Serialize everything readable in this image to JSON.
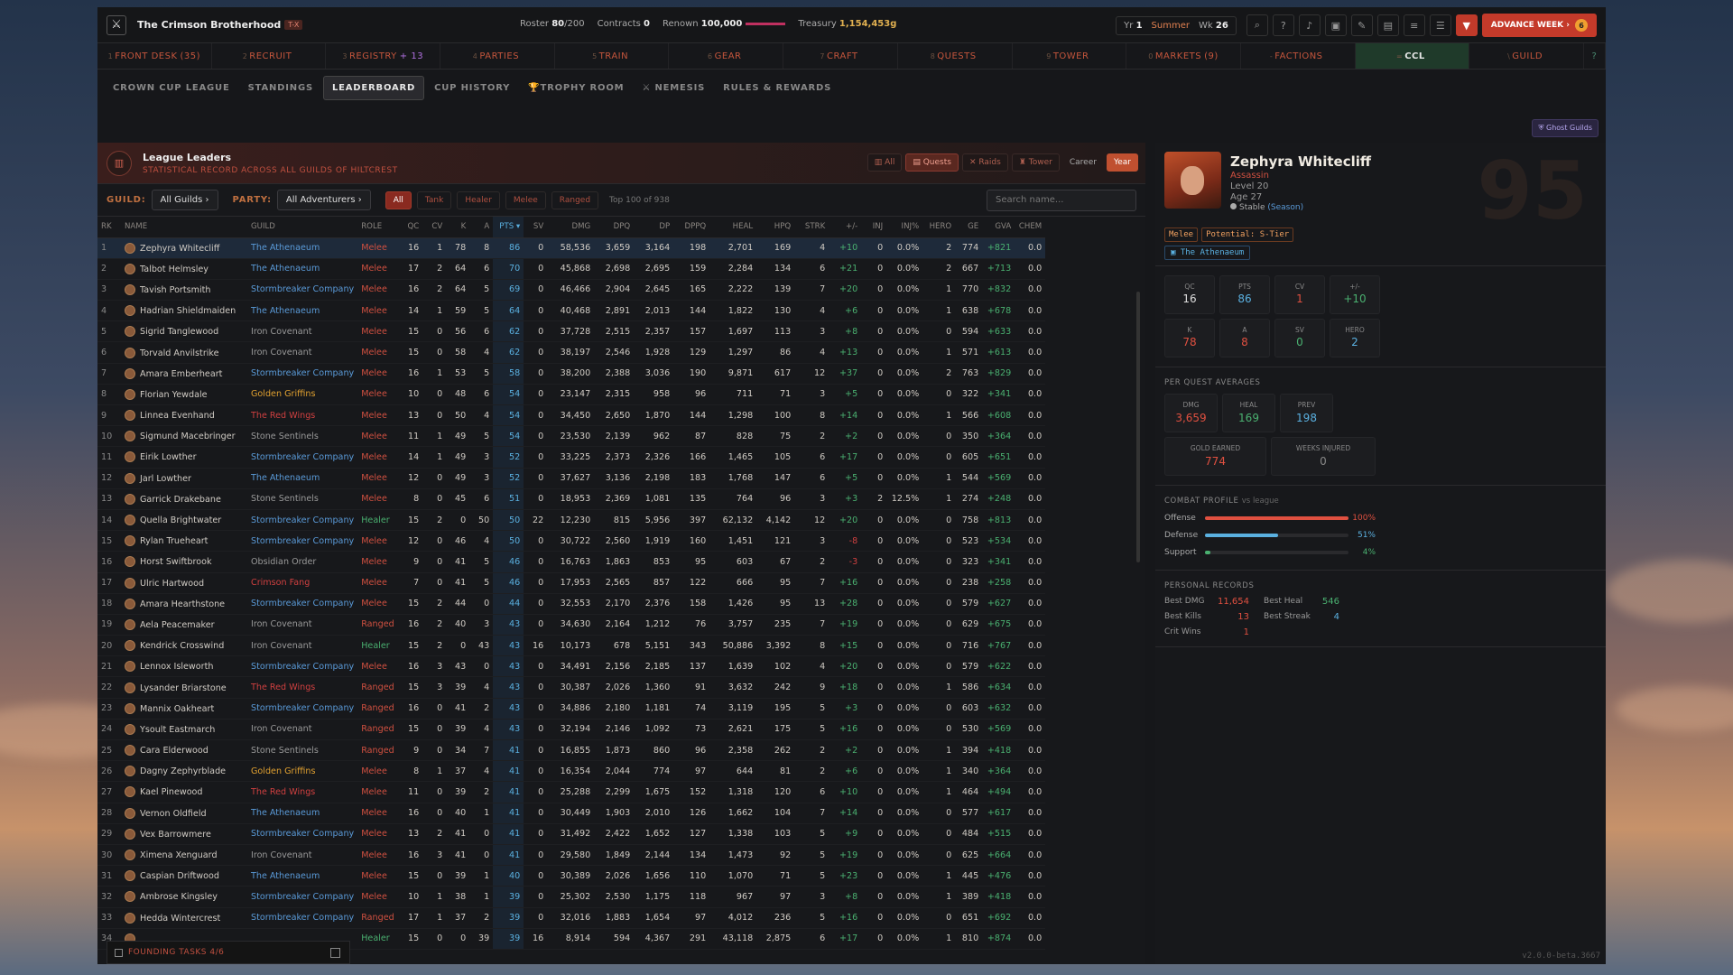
{
  "app": {
    "guild_name": "The Crimson Brotherhood",
    "guild_tag": "T-X",
    "roster_label": "Roster",
    "roster_value": "80",
    "roster_max": "/200",
    "contracts_label": "Contracts",
    "contracts_value": "0",
    "renown_label": "Renown",
    "renown_value": "100,000",
    "treasury_label": "Treasury",
    "treasury_value": "1,154,453g",
    "year_label": "Yr",
    "year_value": "1",
    "season": "Summer",
    "week_label": "Wk",
    "week_value": "26",
    "advance_label": "ADVANCE WEEK ›",
    "advance_badge": "6",
    "version": "v2.0.0-beta.3667"
  },
  "main_nav": [
    {
      "key": "1",
      "label": "FRONT DESK",
      "extra": "(35)"
    },
    {
      "key": "2",
      "label": "RECRUIT",
      "extra": ""
    },
    {
      "key": "3",
      "label": "REGISTRY",
      "extra": "+ 13"
    },
    {
      "key": "4",
      "label": "PARTIES",
      "extra": ""
    },
    {
      "key": "5",
      "label": "TRAIN",
      "extra": ""
    },
    {
      "key": "6",
      "label": "GEAR",
      "extra": ""
    },
    {
      "key": "7",
      "label": "CRAFT",
      "extra": ""
    },
    {
      "key": "8",
      "label": "QUESTS",
      "extra": ""
    },
    {
      "key": "9",
      "label": "TOWER",
      "extra": ""
    },
    {
      "key": "0",
      "label": "MARKETS",
      "extra": "(9)"
    },
    {
      "key": "-",
      "label": "FACTIONS",
      "extra": ""
    },
    {
      "key": "=",
      "label": "CCL",
      "extra": ""
    },
    {
      "key": "\\",
      "label": "GUILD",
      "extra": ""
    }
  ],
  "sub_nav": [
    "CROWN CUP LEAGUE",
    "STANDINGS",
    "LEADERBOARD",
    "CUP HISTORY",
    "TROPHY ROOM",
    "NEMESIS",
    "RULES & REWARDS"
  ],
  "ghost_guilds": "Ghost Guilds",
  "leaders": {
    "title": "League Leaders",
    "subtitle": "STATISTICAL RECORD ACROSS ALL GUILDS OF HILTCREST",
    "btn_all": "All",
    "btn_quests": "Quests",
    "btn_raids": "Raids",
    "btn_tower": "Tower",
    "btn_career": "Career",
    "btn_year": "Year"
  },
  "filters": {
    "guild_label": "GUILD:",
    "guild_value": "All Guilds ›",
    "party_label": "PARTY:",
    "party_value": "All Adventurers ›",
    "chips": [
      "All",
      "Tank",
      "Healer",
      "Melee",
      "Ranged"
    ],
    "top_text": "Top 100 of 938",
    "search_placeholder": "Search name..."
  },
  "columns": [
    "RK",
    "NAME",
    "GUILD",
    "ROLE",
    "QC",
    "CV",
    "K",
    "A",
    "PTS ▾",
    "SV",
    "DMG",
    "DPQ",
    "DP",
    "DPPQ",
    "HEAL",
    "HPQ",
    "STRK",
    "+/-",
    "INJ",
    "INJ%",
    "HERO",
    "GE",
    "GVA",
    "CHEM"
  ],
  "rows": [
    [
      "1",
      "Zephyra Whitecliff",
      "The Athenaeum",
      "Melee",
      "16",
      "1",
      "78",
      "8",
      "86",
      "0",
      "58,536",
      "3,659",
      "3,164",
      "198",
      "2,701",
      "169",
      "4",
      "+10",
      "0",
      "0.0%",
      "2",
      "774",
      "+821",
      "0.0"
    ],
    [
      "2",
      "Talbot Helmsley",
      "The Athenaeum",
      "Melee",
      "17",
      "2",
      "64",
      "6",
      "70",
      "0",
      "45,868",
      "2,698",
      "2,695",
      "159",
      "2,284",
      "134",
      "6",
      "+21",
      "0",
      "0.0%",
      "2",
      "667",
      "+713",
      "0.0"
    ],
    [
      "3",
      "Tavish Portsmith",
      "Stormbreaker Company",
      "Melee",
      "16",
      "2",
      "64",
      "5",
      "69",
      "0",
      "46,466",
      "2,904",
      "2,645",
      "165",
      "2,222",
      "139",
      "7",
      "+20",
      "0",
      "0.0%",
      "1",
      "770",
      "+832",
      "0.0"
    ],
    [
      "4",
      "Hadrian Shieldmaiden",
      "The Athenaeum",
      "Melee",
      "14",
      "1",
      "59",
      "5",
      "64",
      "0",
      "40,468",
      "2,891",
      "2,013",
      "144",
      "1,822",
      "130",
      "4",
      "+6",
      "0",
      "0.0%",
      "1",
      "638",
      "+678",
      "0.0"
    ],
    [
      "5",
      "Sigrid Tanglewood",
      "Iron Covenant",
      "Melee",
      "15",
      "0",
      "56",
      "6",
      "62",
      "0",
      "37,728",
      "2,515",
      "2,357",
      "157",
      "1,697",
      "113",
      "3",
      "+8",
      "0",
      "0.0%",
      "0",
      "594",
      "+633",
      "0.0"
    ],
    [
      "6",
      "Torvald Anvilstrike",
      "Iron Covenant",
      "Melee",
      "15",
      "0",
      "58",
      "4",
      "62",
      "0",
      "38,197",
      "2,546",
      "1,928",
      "129",
      "1,297",
      "86",
      "4",
      "+13",
      "0",
      "0.0%",
      "1",
      "571",
      "+613",
      "0.0"
    ],
    [
      "7",
      "Amara Emberheart",
      "Stormbreaker Company",
      "Melee",
      "16",
      "1",
      "53",
      "5",
      "58",
      "0",
      "38,200",
      "2,388",
      "3,036",
      "190",
      "9,871",
      "617",
      "12",
      "+37",
      "0",
      "0.0%",
      "2",
      "763",
      "+829",
      "0.0"
    ],
    [
      "8",
      "Florian Yewdale",
      "Golden Griffins",
      "Melee",
      "10",
      "0",
      "48",
      "6",
      "54",
      "0",
      "23,147",
      "2,315",
      "958",
      "96",
      "711",
      "71",
      "3",
      "+5",
      "0",
      "0.0%",
      "0",
      "322",
      "+341",
      "0.0"
    ],
    [
      "9",
      "Linnea Evenhand",
      "The Red Wings",
      "Melee",
      "13",
      "0",
      "50",
      "4",
      "54",
      "0",
      "34,450",
      "2,650",
      "1,870",
      "144",
      "1,298",
      "100",
      "8",
      "+14",
      "0",
      "0.0%",
      "1",
      "566",
      "+608",
      "0.0"
    ],
    [
      "10",
      "Sigmund Macebringer",
      "Stone Sentinels",
      "Melee",
      "11",
      "1",
      "49",
      "5",
      "54",
      "0",
      "23,530",
      "2,139",
      "962",
      "87",
      "828",
      "75",
      "2",
      "+2",
      "0",
      "0.0%",
      "0",
      "350",
      "+364",
      "0.0"
    ],
    [
      "11",
      "Eirik Lowther",
      "Stormbreaker Company",
      "Melee",
      "14",
      "1",
      "49",
      "3",
      "52",
      "0",
      "33,225",
      "2,373",
      "2,326",
      "166",
      "1,465",
      "105",
      "6",
      "+17",
      "0",
      "0.0%",
      "0",
      "605",
      "+651",
      "0.0"
    ],
    [
      "12",
      "Jarl Lowther",
      "The Athenaeum",
      "Melee",
      "12",
      "0",
      "49",
      "3",
      "52",
      "0",
      "37,627",
      "3,136",
      "2,198",
      "183",
      "1,768",
      "147",
      "6",
      "+5",
      "0",
      "0.0%",
      "1",
      "544",
      "+569",
      "0.0"
    ],
    [
      "13",
      "Garrick Drakebane",
      "Stone Sentinels",
      "Melee",
      "8",
      "0",
      "45",
      "6",
      "51",
      "0",
      "18,953",
      "2,369",
      "1,081",
      "135",
      "764",
      "96",
      "3",
      "+3",
      "2",
      "12.5%",
      "1",
      "274",
      "+248",
      "0.0"
    ],
    [
      "14",
      "Quella Brightwater",
      "Stormbreaker Company",
      "Healer",
      "15",
      "2",
      "0",
      "50",
      "50",
      "22",
      "12,230",
      "815",
      "5,956",
      "397",
      "62,132",
      "4,142",
      "12",
      "+20",
      "0",
      "0.0%",
      "0",
      "758",
      "+813",
      "0.0"
    ],
    [
      "15",
      "Rylan Trueheart",
      "Stormbreaker Company",
      "Melee",
      "12",
      "0",
      "46",
      "4",
      "50",
      "0",
      "30,722",
      "2,560",
      "1,919",
      "160",
      "1,451",
      "121",
      "3",
      "-8",
      "0",
      "0.0%",
      "0",
      "523",
      "+534",
      "0.0"
    ],
    [
      "16",
      "Horst Swiftbrook",
      "Obsidian Order",
      "Melee",
      "9",
      "0",
      "41",
      "5",
      "46",
      "0",
      "16,763",
      "1,863",
      "853",
      "95",
      "603",
      "67",
      "2",
      "-3",
      "0",
      "0.0%",
      "0",
      "323",
      "+341",
      "0.0"
    ],
    [
      "17",
      "Ulric Hartwood",
      "Crimson Fang",
      "Melee",
      "7",
      "0",
      "41",
      "5",
      "46",
      "0",
      "17,953",
      "2,565",
      "857",
      "122",
      "666",
      "95",
      "7",
      "+16",
      "0",
      "0.0%",
      "0",
      "238",
      "+258",
      "0.0"
    ],
    [
      "18",
      "Amara Hearthstone",
      "Stormbreaker Company",
      "Melee",
      "15",
      "2",
      "44",
      "0",
      "44",
      "0",
      "32,553",
      "2,170",
      "2,376",
      "158",
      "1,426",
      "95",
      "13",
      "+28",
      "0",
      "0.0%",
      "0",
      "579",
      "+627",
      "0.0"
    ],
    [
      "19",
      "Aela Peacemaker",
      "Iron Covenant",
      "Ranged",
      "16",
      "2",
      "40",
      "3",
      "43",
      "0",
      "34,630",
      "2,164",
      "1,212",
      "76",
      "3,757",
      "235",
      "7",
      "+19",
      "0",
      "0.0%",
      "0",
      "629",
      "+675",
      "0.0"
    ],
    [
      "20",
      "Kendrick Crosswind",
      "Iron Covenant",
      "Healer",
      "15",
      "2",
      "0",
      "43",
      "43",
      "16",
      "10,173",
      "678",
      "5,151",
      "343",
      "50,886",
      "3,392",
      "8",
      "+15",
      "0",
      "0.0%",
      "0",
      "716",
      "+767",
      "0.0"
    ],
    [
      "21",
      "Lennox Isleworth",
      "Stormbreaker Company",
      "Melee",
      "16",
      "3",
      "43",
      "0",
      "43",
      "0",
      "34,491",
      "2,156",
      "2,185",
      "137",
      "1,639",
      "102",
      "4",
      "+20",
      "0",
      "0.0%",
      "0",
      "579",
      "+622",
      "0.0"
    ],
    [
      "22",
      "Lysander Briarstone",
      "The Red Wings",
      "Ranged",
      "15",
      "3",
      "39",
      "4",
      "43",
      "0",
      "30,387",
      "2,026",
      "1,360",
      "91",
      "3,632",
      "242",
      "9",
      "+18",
      "0",
      "0.0%",
      "1",
      "586",
      "+634",
      "0.0"
    ],
    [
      "23",
      "Mannix Oakheart",
      "Stormbreaker Company",
      "Ranged",
      "16",
      "0",
      "41",
      "2",
      "43",
      "0",
      "34,886",
      "2,180",
      "1,181",
      "74",
      "3,119",
      "195",
      "5",
      "+3",
      "0",
      "0.0%",
      "0",
      "603",
      "+632",
      "0.0"
    ],
    [
      "24",
      "Ysoult Eastmarch",
      "Iron Covenant",
      "Ranged",
      "15",
      "0",
      "39",
      "4",
      "43",
      "0",
      "32,194",
      "2,146",
      "1,092",
      "73",
      "2,621",
      "175",
      "5",
      "+16",
      "0",
      "0.0%",
      "0",
      "530",
      "+569",
      "0.0"
    ],
    [
      "25",
      "Cara Elderwood",
      "Stone Sentinels",
      "Ranged",
      "9",
      "0",
      "34",
      "7",
      "41",
      "0",
      "16,855",
      "1,873",
      "860",
      "96",
      "2,358",
      "262",
      "2",
      "+2",
      "0",
      "0.0%",
      "1",
      "394",
      "+418",
      "0.0"
    ],
    [
      "26",
      "Dagny Zephyrblade",
      "Golden Griffins",
      "Melee",
      "8",
      "1",
      "37",
      "4",
      "41",
      "0",
      "16,354",
      "2,044",
      "774",
      "97",
      "644",
      "81",
      "2",
      "+6",
      "0",
      "0.0%",
      "1",
      "340",
      "+364",
      "0.0"
    ],
    [
      "27",
      "Kael Pinewood",
      "The Red Wings",
      "Melee",
      "11",
      "0",
      "39",
      "2",
      "41",
      "0",
      "25,288",
      "2,299",
      "1,675",
      "152",
      "1,318",
      "120",
      "6",
      "+10",
      "0",
      "0.0%",
      "1",
      "464",
      "+494",
      "0.0"
    ],
    [
      "28",
      "Vernon Oldfield",
      "The Athenaeum",
      "Melee",
      "16",
      "0",
      "40",
      "1",
      "41",
      "0",
      "30,449",
      "1,903",
      "2,010",
      "126",
      "1,662",
      "104",
      "7",
      "+14",
      "0",
      "0.0%",
      "0",
      "577",
      "+617",
      "0.0"
    ],
    [
      "29",
      "Vex Barrowmere",
      "Stormbreaker Company",
      "Melee",
      "13",
      "2",
      "41",
      "0",
      "41",
      "0",
      "31,492",
      "2,422",
      "1,652",
      "127",
      "1,338",
      "103",
      "5",
      "+9",
      "0",
      "0.0%",
      "0",
      "484",
      "+515",
      "0.0"
    ],
    [
      "30",
      "Ximena Xenguard",
      "Iron Covenant",
      "Melee",
      "16",
      "3",
      "41",
      "0",
      "41",
      "0",
      "29,580",
      "1,849",
      "2,144",
      "134",
      "1,473",
      "92",
      "5",
      "+19",
      "0",
      "0.0%",
      "0",
      "625",
      "+664",
      "0.0"
    ],
    [
      "31",
      "Caspian Driftwood",
      "The Athenaeum",
      "Melee",
      "15",
      "0",
      "39",
      "1",
      "40",
      "0",
      "30,389",
      "2,026",
      "1,656",
      "110",
      "1,070",
      "71",
      "5",
      "+23",
      "0",
      "0.0%",
      "1",
      "445",
      "+476",
      "0.0"
    ],
    [
      "32",
      "Ambrose Kingsley",
      "Stormbreaker Company",
      "Melee",
      "10",
      "1",
      "38",
      "1",
      "39",
      "0",
      "25,302",
      "2,530",
      "1,175",
      "118",
      "967",
      "97",
      "3",
      "+8",
      "0",
      "0.0%",
      "1",
      "389",
      "+418",
      "0.0"
    ],
    [
      "33",
      "Hedda Wintercrest",
      "Stormbreaker Company",
      "Ranged",
      "17",
      "1",
      "37",
      "2",
      "39",
      "0",
      "32,016",
      "1,883",
      "1,654",
      "97",
      "4,012",
      "236",
      "5",
      "+16",
      "0",
      "0.0%",
      "0",
      "651",
      "+692",
      "0.0"
    ],
    [
      "34",
      "",
      "",
      "Healer",
      "15",
      "0",
      "0",
      "39",
      "39",
      "16",
      "8,914",
      "594",
      "4,367",
      "291",
      "43,118",
      "2,875",
      "6",
      "+17",
      "0",
      "0.0%",
      "1",
      "810",
      "+874",
      "0.0"
    ]
  ],
  "founding_tasks": "FOUNDING TASKS 4/6",
  "profile": {
    "name": "Zephyra Whitecliff",
    "role": "Assassin",
    "level": "Level 20",
    "age": "Age 27",
    "status": "Stable",
    "status_scope": "(Season)",
    "big_number": "95",
    "tag_role": "Melee",
    "tag_potential": "Potential: S-Tier",
    "guild": "The Athenaeum",
    "stats": [
      {
        "label": "QC",
        "value": "16",
        "color": "#dddddd"
      },
      {
        "label": "PTS",
        "value": "86",
        "color": "#5ab0e0"
      },
      {
        "label": "CV",
        "value": "1",
        "color": "#e05040"
      },
      {
        "label": "+/-",
        "value": "+10",
        "color": "#4ab070"
      },
      {
        "label": "K",
        "value": "78",
        "color": "#e05040"
      },
      {
        "label": "A",
        "value": "8",
        "color": "#e05040"
      },
      {
        "label": "SV",
        "value": "0",
        "color": "#4ab070"
      },
      {
        "label": "HERO",
        "value": "2",
        "color": "#5ab0e0"
      }
    ],
    "per_quest_title": "PER QUEST AVERAGES",
    "averages": [
      {
        "label": "DMG",
        "value": "3,659",
        "color": "#e05040"
      },
      {
        "label": "HEAL",
        "value": "169",
        "color": "#4ab070"
      },
      {
        "label": "PREV",
        "value": "198",
        "color": "#5ab0e0"
      }
    ],
    "gold_label": "GOLD EARNED",
    "gold_value": "774",
    "weeks_label": "WEEKS INJURED",
    "weeks_value": "0",
    "combat_title": "COMBAT PROFILE",
    "combat_vs": "vs league",
    "combat": [
      {
        "label": "Offense",
        "value": 1.0,
        "text": "100%",
        "color": "#e05040"
      },
      {
        "label": "Defense",
        "value": 0.51,
        "text": "51%",
        "color": "#5ab0e0"
      },
      {
        "label": "Support",
        "value": 0.04,
        "text": "4%",
        "color": "#4ab070"
      }
    ],
    "records_title": "PERSONAL RECORDS",
    "records": [
      {
        "label": "Best DMG",
        "value": "11,654",
        "color": "#e05040"
      },
      {
        "label": "Best Heal",
        "value": "546",
        "color": "#4ab070"
      },
      {
        "label": "Best Kills",
        "value": "13",
        "color": "#e05040"
      },
      {
        "label": "Best Streak",
        "value": "4",
        "color": "#5ab0e0"
      },
      {
        "label": "Crit Wins",
        "value": "1",
        "color": "#e05040"
      }
    ]
  }
}
